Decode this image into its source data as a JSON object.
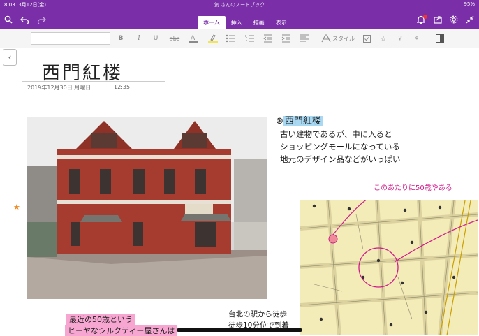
{
  "status_bar": {
    "time": "8:03",
    "date": "3月12日(金)",
    "notebook": "気 さんのノートブック",
    "battery": "95%"
  },
  "toolbar": {
    "tabs": [
      {
        "label": "ホーム",
        "active": true
      },
      {
        "label": "挿入",
        "active": false
      },
      {
        "label": "描画",
        "active": false
      },
      {
        "label": "表示",
        "active": false
      }
    ],
    "icons": [
      "search-icon",
      "undo-icon",
      "redo-icon",
      "bell-icon",
      "share-icon",
      "gear-icon",
      "collapse-icon"
    ]
  },
  "ribbon": {
    "style_label": "スタイル",
    "items": [
      "bold",
      "italic",
      "underline",
      "strikethrough",
      "font-color",
      "highlight",
      "bullets",
      "numbering",
      "outdent",
      "indent",
      "align",
      "style",
      "checkbox",
      "star",
      "help",
      "tag",
      "sidebar"
    ]
  },
  "page": {
    "title": "西門紅楼",
    "date": "2019年12月30日 月曜日",
    "time": "12:35"
  },
  "notes": {
    "title": "西門紅楼",
    "lines": [
      "古い建物であるが、中に入ると",
      "ショッピングモールになっている",
      "地元のデザイン品などがいっぱい"
    ],
    "pink_note": "このあたりに50歳やある",
    "bottom_left": [
      "最近の50歳という",
      "ヒーヤなシルクティー屋さんは"
    ],
    "bottom_mid": [
      "台北の駅から徒歩",
      "徒歩10分位で到着"
    ]
  },
  "colors": {
    "brand": "#7a2fa8",
    "highlight_blue": "#a9d8f3",
    "highlight_pink": "#f7a6d2",
    "pen_pink": "#d11a8a",
    "star": "#f08a24"
  }
}
